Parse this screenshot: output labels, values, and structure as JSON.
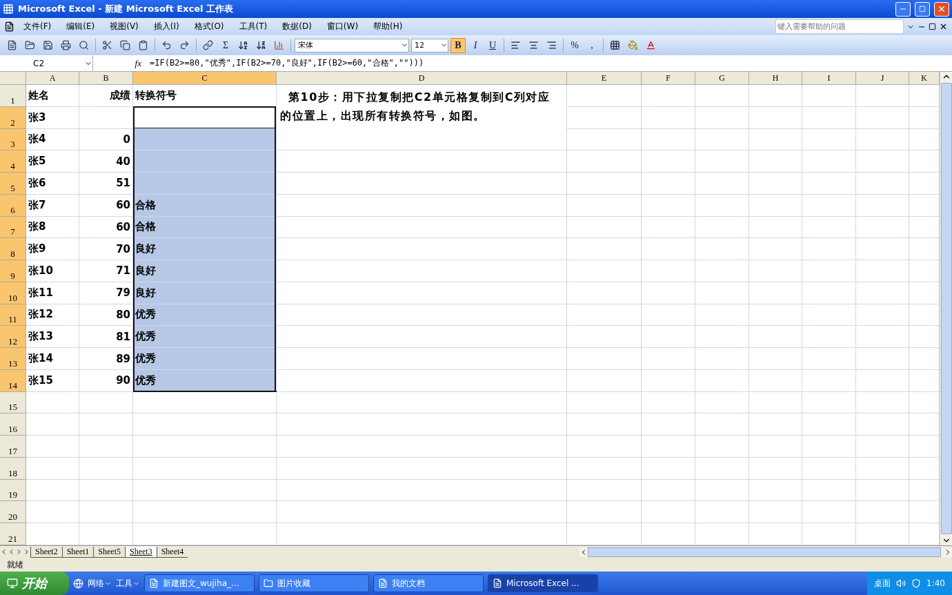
{
  "window": {
    "title": "Microsoft Excel - 新建 Microsoft Excel 工作表"
  },
  "menu": [
    "文件(F)",
    "编辑(E)",
    "视图(V)",
    "插入(I)",
    "格式(O)",
    "工具(T)",
    "数据(D)",
    "窗口(W)",
    "帮助(H)"
  ],
  "help_box": {
    "placeholder": "键入需要帮助的问题"
  },
  "toolbar": {
    "sum": "Σ",
    "font": "宋体",
    "size": "12",
    "styles": [
      {
        "label": "B",
        "selected": true
      },
      {
        "label": "I",
        "selected": false
      },
      {
        "label": "U",
        "selected": false
      }
    ],
    "percent": "%",
    "comma": ","
  },
  "formula_bar": {
    "name_box": "C2",
    "fx": "fx",
    "formula": "=IF(B2>=80,\"优秀\",IF(B2>=70,\"良好\",IF(B2>=60,\"合格\",\"\")))"
  },
  "columns": [
    {
      "label": "A",
      "selected": false
    },
    {
      "label": "B",
      "selected": false
    },
    {
      "label": "C",
      "selected": true
    },
    {
      "label": "D",
      "selected": false
    },
    {
      "label": "E",
      "selected": false
    },
    {
      "label": "F",
      "selected": false
    },
    {
      "label": "G",
      "selected": false
    },
    {
      "label": "H",
      "selected": false
    },
    {
      "label": "I",
      "selected": false
    },
    {
      "label": "J",
      "selected": false
    },
    {
      "label": "K",
      "selected": false
    }
  ],
  "rows": [
    {
      "header": "1",
      "selected": false,
      "cells": {
        "A": "姓名",
        "B": "成绩",
        "C": "转换符号",
        "D": "第10步：用下拉复制把C2单元格复制到C列对应的位置上，出现所有转换符号，如图。"
      }
    },
    {
      "header": "2",
      "selected": true,
      "cells": {
        "A": "张3"
      }
    },
    {
      "header": "3",
      "selected": true,
      "cells": {
        "A": "张4",
        "B": "0"
      }
    },
    {
      "header": "4",
      "selected": true,
      "cells": {
        "A": "张5",
        "B": "40"
      }
    },
    {
      "header": "5",
      "selected": true,
      "cells": {
        "A": "张6",
        "B": "51"
      }
    },
    {
      "header": "6",
      "selected": true,
      "cells": {
        "A": "张7",
        "B": "60",
        "C": "合格"
      }
    },
    {
      "header": "7",
      "selected": true,
      "cells": {
        "A": "张8",
        "B": "60",
        "C": "合格"
      }
    },
    {
      "header": "8",
      "selected": true,
      "cells": {
        "A": "张9",
        "B": "70",
        "C": "良好"
      }
    },
    {
      "header": "9",
      "selected": true,
      "cells": {
        "A": "张10",
        "B": "71",
        "C": "良好"
      }
    },
    {
      "header": "10",
      "selected": true,
      "cells": {
        "A": "张11",
        "B": "79",
        "C": "良好"
      }
    },
    {
      "header": "11",
      "selected": true,
      "cells": {
        "A": "张12",
        "B": "80",
        "C": "优秀"
      }
    },
    {
      "header": "12",
      "selected": true,
      "cells": {
        "A": "张13",
        "B": "81",
        "C": "优秀"
      }
    },
    {
      "header": "13",
      "selected": true,
      "cells": {
        "A": "张14",
        "B": "89",
        "C": "优秀"
      }
    },
    {
      "header": "14",
      "selected": true,
      "cells": {
        "A": "张15",
        "B": "90",
        "C": "优秀"
      }
    },
    {
      "header": "15",
      "selected": false,
      "cells": {}
    },
    {
      "header": "16",
      "selected": false,
      "cells": {}
    },
    {
      "header": "17",
      "selected": false,
      "cells": {}
    },
    {
      "header": "18",
      "selected": false,
      "cells": {}
    },
    {
      "header": "19",
      "selected": false,
      "cells": {}
    },
    {
      "header": "20",
      "selected": false,
      "cells": {}
    },
    {
      "header": "21",
      "selected": false,
      "cells": {}
    }
  ],
  "sheet_tabs": [
    {
      "label": "Sheet2",
      "selected": false
    },
    {
      "label": "Sheet1",
      "selected": false
    },
    {
      "label": "Sheet5",
      "selected": false
    },
    {
      "label": "Sheet3",
      "selected": true
    },
    {
      "label": "Sheet4",
      "selected": false
    }
  ],
  "status_bar": "就绪",
  "taskbar": {
    "start": "开始",
    "quick": [
      "网络",
      "工具"
    ],
    "tasks": [
      {
        "label": "新建图文_wujiha_...",
        "selected": false
      },
      {
        "label": "图片收藏",
        "selected": false
      },
      {
        "label": "我的文档",
        "selected": false
      },
      {
        "label": "Microsoft Excel ...",
        "selected": true
      }
    ],
    "tray": "桌面",
    "clock": "1:40"
  }
}
